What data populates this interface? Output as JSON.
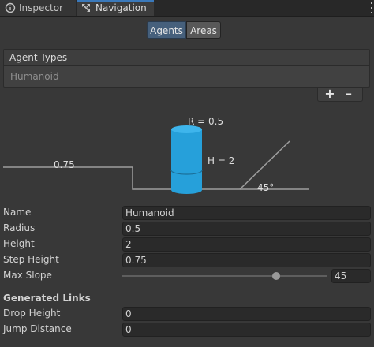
{
  "tabs": [
    {
      "label": "Inspector",
      "icon": "info-icon",
      "active": false
    },
    {
      "label": "Navigation",
      "icon": "navigation-icon",
      "active": true
    }
  ],
  "toolbar": {
    "agents_label": "Agents",
    "areas_label": "Areas",
    "selected": "Agents"
  },
  "agent_types": {
    "header": "Agent Types",
    "items": [
      "Humanoid"
    ],
    "add_label": "+",
    "remove_label": "–"
  },
  "diagram": {
    "radius_label": "R = 0.5",
    "height_label": "H = 2",
    "step_label": "0.75",
    "slope_label": "45°",
    "cylinder_color": "#26a0da"
  },
  "fields": {
    "name": {
      "label": "Name",
      "value": "Humanoid"
    },
    "radius": {
      "label": "Radius",
      "value": "0.5"
    },
    "height": {
      "label": "Height",
      "value": "2"
    },
    "step_height": {
      "label": "Step Height",
      "value": "0.75"
    },
    "max_slope": {
      "label": "Max Slope",
      "value": "45",
      "slider_fraction": 0.75
    }
  },
  "generated_links": {
    "heading": "Generated Links",
    "drop_height": {
      "label": "Drop Height",
      "value": "0"
    },
    "jump_distance": {
      "label": "Jump Distance",
      "value": "0"
    }
  },
  "colors": {
    "accent": "#3a79bb",
    "selected_segment": "#46607c",
    "background": "#383838"
  }
}
